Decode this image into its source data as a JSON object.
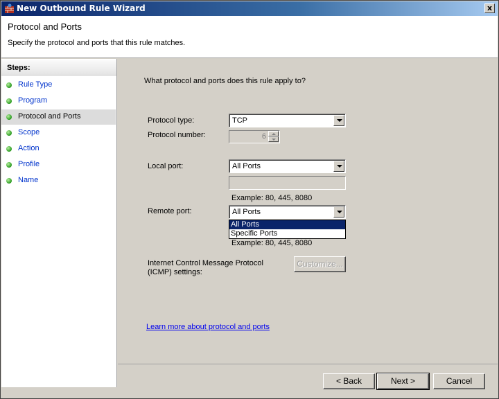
{
  "window": {
    "title": "New Outbound Rule Wizard",
    "close_label": "x"
  },
  "header": {
    "title": "Protocol and Ports",
    "subtitle": "Specify the protocol and ports that this rule matches."
  },
  "steps": {
    "heading": "Steps:",
    "items": [
      {
        "label": "Rule Type"
      },
      {
        "label": "Program"
      },
      {
        "label": "Protocol and Ports"
      },
      {
        "label": "Scope"
      },
      {
        "label": "Action"
      },
      {
        "label": "Profile"
      },
      {
        "label": "Name"
      }
    ],
    "active": "Protocol and Ports"
  },
  "main": {
    "question": "What protocol and ports does this rule apply to?",
    "protocol_type": {
      "label": "Protocol type:",
      "value": "TCP"
    },
    "protocol_number": {
      "label": "Protocol number:",
      "value": "6"
    },
    "local_port": {
      "label": "Local port:",
      "value": "All Ports",
      "text": "",
      "example": "Example: 80, 445, 8080"
    },
    "remote_port": {
      "label": "Remote port:",
      "value": "All Ports",
      "options": [
        "All Ports",
        "Specific Ports"
      ],
      "example": "Example: 80, 445, 8080"
    },
    "icmp": {
      "label_line1": "Internet Control Message Protocol",
      "label_line2": "(ICMP) settings:",
      "button": "Customize..."
    },
    "learn_more": "Learn more about protocol and ports"
  },
  "footer": {
    "back": "< Back",
    "next": "Next >",
    "cancel": "Cancel"
  },
  "colors": {
    "accent": "#0a246a",
    "link": "#0000ee",
    "step_link": "#0033cc",
    "dot": "#2a9a20"
  }
}
